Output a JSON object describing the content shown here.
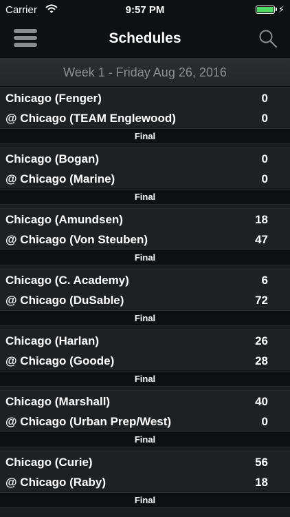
{
  "status_bar": {
    "carrier": "Carrier",
    "time": "9:57 PM"
  },
  "nav": {
    "title": "Schedules"
  },
  "week_header": "Week 1 - Friday Aug 26, 2016",
  "games": [
    {
      "home": "Chicago (Fenger)",
      "home_score": "0",
      "away": "@ Chicago (TEAM Englewood)",
      "away_score": "0",
      "status": "Final"
    },
    {
      "home": "Chicago (Bogan)",
      "home_score": "0",
      "away": "@ Chicago (Marine)",
      "away_score": "0",
      "status": "Final"
    },
    {
      "home": "Chicago (Amundsen)",
      "home_score": "18",
      "away": "@ Chicago (Von Steuben)",
      "away_score": "47",
      "status": "Final"
    },
    {
      "home": "Chicago (C. Academy)",
      "home_score": "6",
      "away": "@ Chicago (DuSable)",
      "away_score": "72",
      "status": "Final"
    },
    {
      "home": "Chicago (Harlan)",
      "home_score": "26",
      "away": "@ Chicago (Goode)",
      "away_score": "28",
      "status": "Final"
    },
    {
      "home": "Chicago (Marshall)",
      "home_score": "40",
      "away": "@ Chicago (Urban Prep/West)",
      "away_score": "0",
      "status": "Final"
    },
    {
      "home": "Chicago (Curie)",
      "home_score": "56",
      "away": "@ Chicago (Raby)",
      "away_score": "18",
      "status": "Final"
    }
  ],
  "colors": {
    "background": "#1b1c1e",
    "bar": "#0f1011",
    "battery": "#4cd964",
    "header_text": "#8b8d92"
  },
  "icons": {
    "menu": "hamburger-menu-icon",
    "search": "search-icon",
    "wifi": "wifi-icon",
    "battery": "battery-icon"
  }
}
